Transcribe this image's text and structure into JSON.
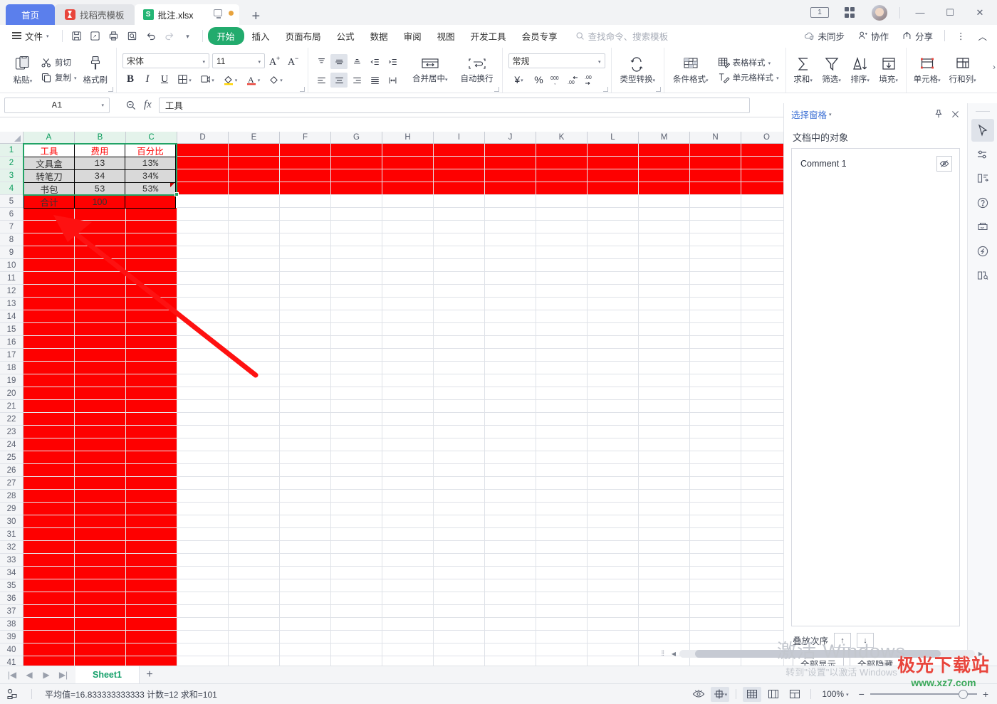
{
  "window": {
    "tabs": [
      {
        "label": "首页",
        "type": "home"
      },
      {
        "label": "找稻壳模板",
        "type": "template"
      },
      {
        "label": "批注.xlsx",
        "type": "file",
        "active": true
      }
    ],
    "new_tab_label": "+",
    "controls": {
      "pages_badge": "1",
      "grid_label": "grid-view",
      "minimize": "—",
      "maximize": "☐",
      "close": "✕"
    }
  },
  "menubar": {
    "file_label": "文件",
    "quick_icons": [
      "save-icon",
      "save-as-icon",
      "print-icon",
      "print-preview-icon",
      "undo-icon",
      "redo-icon",
      "customize-icon"
    ],
    "items": [
      {
        "label": "开始",
        "active": true
      },
      {
        "label": "插入"
      },
      {
        "label": "页面布局"
      },
      {
        "label": "公式"
      },
      {
        "label": "数据"
      },
      {
        "label": "审阅"
      },
      {
        "label": "视图"
      },
      {
        "label": "开发工具"
      },
      {
        "label": "会员专享"
      }
    ],
    "search_placeholder": "查找命令、搜索模板",
    "right": [
      {
        "label": "未同步",
        "icon": "cloud-sync-icon"
      },
      {
        "label": "协作",
        "icon": "collaborate-icon"
      },
      {
        "label": "分享",
        "icon": "share-icon"
      }
    ],
    "more_label": "⋮",
    "collapse_label": "︿"
  },
  "ribbon": {
    "clipboard": {
      "paste": "粘贴",
      "cut": "剪切",
      "copy": "复制",
      "format_painter": "格式刷"
    },
    "font": {
      "family": "宋体",
      "size": "11",
      "grow": "A+",
      "shrink": "A−",
      "bold": "B",
      "italic": "I",
      "underline": "U",
      "border": "borders-icon",
      "effects": "text-effects-icon",
      "fill": "fill-color-icon",
      "color": "font-color-icon",
      "clear": "clear-format-icon"
    },
    "align": {
      "merge": "合并居中",
      "wrap": "自动换行"
    },
    "number": {
      "format": "常规",
      "currency": "¥",
      "percent": "%",
      "comma": "000",
      "dec_inc": "增加小数位",
      "dec_dec": "减少小数位",
      "convert": "类型转换"
    },
    "styles": {
      "cond": "条件格式",
      "table": "表格样式",
      "cell": "单元格样式"
    },
    "edit": {
      "sum": "求和",
      "filter": "筛选",
      "sort": "排序",
      "fill": "填充"
    },
    "cells": {
      "cell": "单元格",
      "rowcol": "行和列"
    }
  },
  "formula_bar": {
    "name_box": "A1",
    "fx_label": "fx",
    "content": "工具",
    "zoom_icon": "zoom-out-icon"
  },
  "grid": {
    "columns": [
      "A",
      "B",
      "C",
      "D",
      "E",
      "F",
      "G",
      "H",
      "I",
      "J",
      "K",
      "L",
      "M",
      "N",
      "O"
    ],
    "selected_columns": [
      "A",
      "B",
      "C"
    ],
    "selected_rows": [
      1,
      2,
      3,
      4
    ],
    "row_count": 41,
    "table": {
      "headers": [
        "工具",
        "费用",
        "百分比"
      ],
      "rows": [
        [
          "文具盒",
          "13",
          "13%"
        ],
        [
          "转笔刀",
          "34",
          "34%"
        ],
        [
          "书包",
          "53",
          "53%"
        ],
        [
          "合计",
          "100",
          ""
        ]
      ]
    },
    "selection_range": "A1:C4",
    "comment_cell": "C4"
  },
  "selection_pane": {
    "title": "选择窗格",
    "subtitle": "文档中的对象",
    "objects": [
      {
        "name": "Comment 1",
        "visible": false
      }
    ],
    "order_label": "叠放次序",
    "up_label": "↑",
    "down_label": "↓",
    "show_all": "全部显示",
    "hide_all": "全部隐藏",
    "pin_icon": "pin-icon",
    "close_icon": "close-icon"
  },
  "rail": {
    "items": [
      {
        "icon": "select-arrow-icon",
        "selected": true
      },
      {
        "icon": "settings-sliders-icon"
      },
      {
        "icon": "layout-icon"
      },
      {
        "icon": "help-icon"
      },
      {
        "icon": "resources-icon"
      },
      {
        "icon": "lightbulb-icon"
      },
      {
        "icon": "docs-icon"
      }
    ]
  },
  "sheetbar": {
    "first": "|◀",
    "prev": "◀",
    "next": "▶",
    "last": "▶|",
    "sheets": [
      {
        "label": "Sheet1",
        "active": true
      }
    ],
    "add_label": "+"
  },
  "statusbar": {
    "mode_icon": "record-macro-icon",
    "stats": "平均值=16.833333333333  计数=12  求和=101",
    "view_icons": [
      "eye-icon",
      "center-icon"
    ],
    "layout_icons": [
      "normal-view-icon",
      "page-break-icon",
      "page-layout-icon"
    ],
    "zoom": "100%",
    "zoom_out": "−",
    "zoom_in": "+"
  },
  "watermark": {
    "line1": "激活 Windows",
    "line2": "转到\"设置\"以激活 Windows"
  },
  "site_logo": {
    "line1": "极光下载站",
    "line2": "www.xz7.com"
  },
  "colors": {
    "accent": "#21a366",
    "red_fill": "#fe0000",
    "tab_blue": "#5b7fec",
    "header_red": "#fe0000"
  }
}
